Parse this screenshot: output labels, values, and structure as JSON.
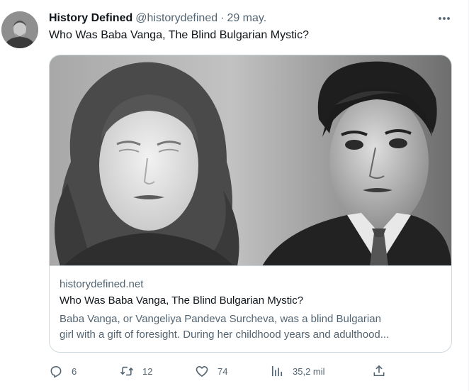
{
  "tweet": {
    "author_name": "History Defined",
    "author_handle": "@historydefined",
    "separator": "·",
    "time": "29 may.",
    "text": "Who Was Baba Vanga, The Blind Bulgarian Mystic?"
  },
  "card": {
    "domain": "historydefined.net",
    "title": "Who Was Baba Vanga, The Blind Bulgarian Mystic?",
    "description_line1": "Baba Vanga, or Vangeliya Pandeva Surcheva, was a blind Bulgarian",
    "description_line2": "girl with a gift of foresight. During her childhood years and adulthood..."
  },
  "actions": {
    "replies": "6",
    "retweets": "12",
    "likes": "74",
    "views": "35,2 mil"
  },
  "icons": [
    "more-icon",
    "reply-icon",
    "retweet-icon",
    "like-icon",
    "views-icon",
    "share-icon"
  ],
  "colors": {
    "text_primary": "#0f1419",
    "text_secondary": "#536471",
    "border": "#cfd9de"
  }
}
